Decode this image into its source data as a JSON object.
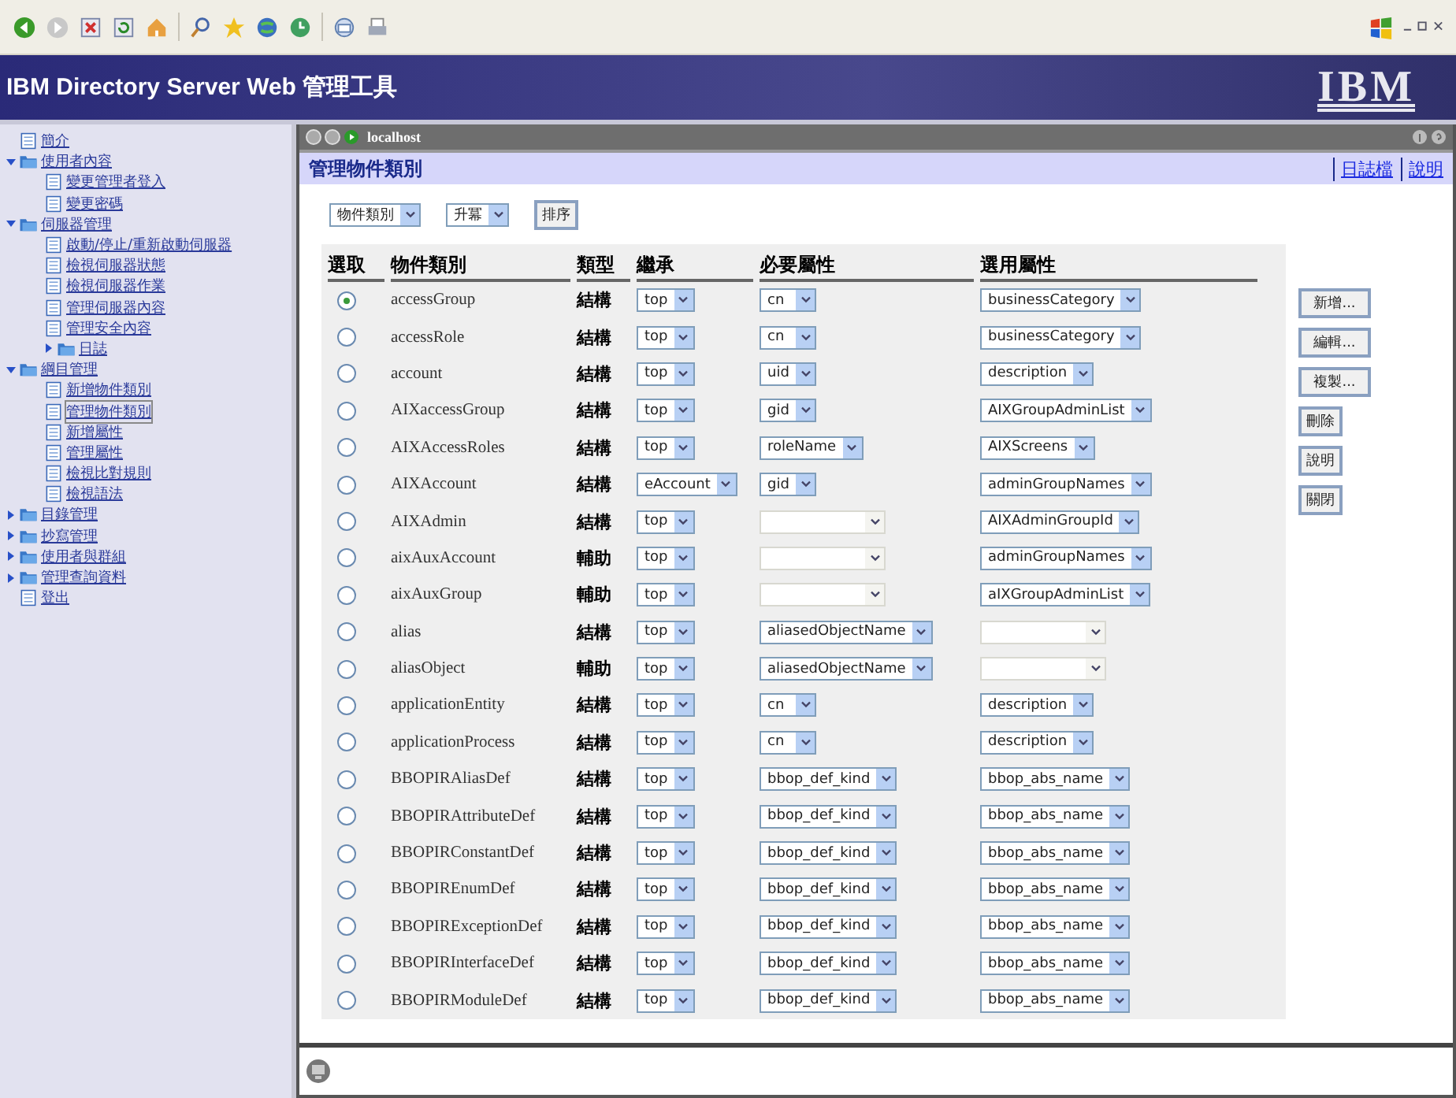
{
  "banner": {
    "title": "IBM Directory Server Web 管理工具",
    "logo": "IBM"
  },
  "sidebar": {
    "items": [
      {
        "label": "簡介",
        "kind": "page"
      },
      {
        "label": "使用者內容",
        "kind": "folder",
        "expanded": true,
        "children": [
          {
            "label": "變更管理者登入",
            "kind": "page",
            "selected": false
          },
          {
            "label": "變更密碼",
            "kind": "page",
            "selected": false
          }
        ]
      },
      {
        "label": "伺服器管理",
        "kind": "folder",
        "expanded": true,
        "children": [
          {
            "label": "啟動/停止/重新啟動伺服器",
            "kind": "page",
            "selected": false
          },
          {
            "label": "檢視伺服器狀態",
            "kind": "page",
            "selected": false
          },
          {
            "label": "檢視伺服器作業",
            "kind": "page",
            "selected": false
          },
          {
            "label": "管理伺服器內容",
            "kind": "page",
            "selected": false
          },
          {
            "label": "管理安全內容",
            "kind": "page",
            "selected": false
          },
          {
            "label": "日誌",
            "kind": "folder",
            "expanded": false
          }
        ]
      },
      {
        "label": "綱目管理",
        "kind": "folder",
        "expanded": true,
        "children": [
          {
            "label": "新增物件類別",
            "kind": "page",
            "selected": false
          },
          {
            "label": "管理物件類別",
            "kind": "page",
            "selected": true
          },
          {
            "label": "新增屬性",
            "kind": "page",
            "selected": false
          },
          {
            "label": "管理屬性",
            "kind": "page",
            "selected": false
          },
          {
            "label": "檢視比對規則",
            "kind": "page",
            "selected": false
          },
          {
            "label": "檢視語法",
            "kind": "page",
            "selected": false
          }
        ]
      },
      {
        "label": "目錄管理",
        "kind": "folder",
        "expanded": false
      },
      {
        "label": "抄寫管理",
        "kind": "folder",
        "expanded": false
      },
      {
        "label": "使用者與群組",
        "kind": "folder",
        "expanded": false
      },
      {
        "label": "管理查詢資料",
        "kind": "folder",
        "expanded": false
      },
      {
        "label": "登出",
        "kind": "page"
      }
    ]
  },
  "frame": {
    "title": "localhost"
  },
  "page": {
    "title": "管理物件類別",
    "links": [
      "日誌檔",
      "說明"
    ]
  },
  "sort": {
    "field": "物件類別",
    "order": "升冪",
    "button": "排序"
  },
  "table": {
    "columns": [
      "選取",
      "物件類別",
      "類型",
      "繼承",
      "必要屬性",
      "選用屬性"
    ],
    "rows": [
      {
        "selected": true,
        "name": "accessGroup",
        "type": "結構",
        "inherit": "top",
        "required": {
          "value": "cn",
          "disabled": false
        },
        "optional": {
          "value": "businessCategory",
          "disabled": false
        }
      },
      {
        "selected": false,
        "name": "accessRole",
        "type": "結構",
        "inherit": "top",
        "required": {
          "value": "cn",
          "disabled": false
        },
        "optional": {
          "value": "businessCategory",
          "disabled": false
        }
      },
      {
        "selected": false,
        "name": "account",
        "type": "結構",
        "inherit": "top",
        "required": {
          "value": "uid",
          "disabled": false
        },
        "optional": {
          "value": "description",
          "disabled": false
        }
      },
      {
        "selected": false,
        "name": "AIXaccessGroup",
        "type": "結構",
        "inherit": "top",
        "required": {
          "value": "gid",
          "disabled": false
        },
        "optional": {
          "value": "AIXGroupAdminList",
          "disabled": false
        }
      },
      {
        "selected": false,
        "name": "AIXAccessRoles",
        "type": "結構",
        "inherit": "top",
        "required": {
          "value": "roleName",
          "disabled": false
        },
        "optional": {
          "value": "AIXScreens",
          "disabled": false
        }
      },
      {
        "selected": false,
        "name": "AIXAccount",
        "type": "結構",
        "inherit": "eAccount",
        "required": {
          "value": "gid",
          "disabled": false
        },
        "optional": {
          "value": "adminGroupNames",
          "disabled": false
        }
      },
      {
        "selected": false,
        "name": "AIXAdmin",
        "type": "結構",
        "inherit": "top",
        "required": {
          "disabled": true
        },
        "optional": {
          "value": "AIXAdminGroupId",
          "disabled": false
        }
      },
      {
        "selected": false,
        "name": "aixAuxAccount",
        "type": "輔助",
        "inherit": "top",
        "required": {
          "disabled": true
        },
        "optional": {
          "value": "adminGroupNames",
          "disabled": false
        }
      },
      {
        "selected": false,
        "name": "aixAuxGroup",
        "type": "輔助",
        "inherit": "top",
        "required": {
          "disabled": true
        },
        "optional": {
          "value": "aIXGroupAdminList",
          "disabled": false
        }
      },
      {
        "selected": false,
        "name": "alias",
        "type": "結構",
        "inherit": "top",
        "required": {
          "value": "aliasedObjectName",
          "disabled": false
        },
        "optional": {
          "disabled": true
        }
      },
      {
        "selected": false,
        "name": "aliasObject",
        "type": "輔助",
        "inherit": "top",
        "required": {
          "value": "aliasedObjectName",
          "disabled": false
        },
        "optional": {
          "disabled": true
        }
      },
      {
        "selected": false,
        "name": "applicationEntity",
        "type": "結構",
        "inherit": "top",
        "required": {
          "value": "cn",
          "disabled": false
        },
        "optional": {
          "value": "description",
          "disabled": false
        }
      },
      {
        "selected": false,
        "name": "applicationProcess",
        "type": "結構",
        "inherit": "top",
        "required": {
          "value": "cn",
          "disabled": false
        },
        "optional": {
          "value": "description",
          "disabled": false
        }
      },
      {
        "selected": false,
        "name": "BBOPIRAliasDef",
        "type": "結構",
        "inherit": "top",
        "required": {
          "value": "bbop_def_kind",
          "disabled": false
        },
        "optional": {
          "value": "bbop_abs_name",
          "disabled": false
        }
      },
      {
        "selected": false,
        "name": "BBOPIRAttributeDef",
        "type": "結構",
        "inherit": "top",
        "required": {
          "value": "bbop_def_kind",
          "disabled": false
        },
        "optional": {
          "value": "bbop_abs_name",
          "disabled": false
        }
      },
      {
        "selected": false,
        "name": "BBOPIRConstantDef",
        "type": "結構",
        "inherit": "top",
        "required": {
          "value": "bbop_def_kind",
          "disabled": false
        },
        "optional": {
          "value": "bbop_abs_name",
          "disabled": false
        }
      },
      {
        "selected": false,
        "name": "BBOPIREnumDef",
        "type": "結構",
        "inherit": "top",
        "required": {
          "value": "bbop_def_kind",
          "disabled": false
        },
        "optional": {
          "value": "bbop_abs_name",
          "disabled": false
        }
      },
      {
        "selected": false,
        "name": "BBOPIRExceptionDef",
        "type": "結構",
        "inherit": "top",
        "required": {
          "value": "bbop_def_kind",
          "disabled": false
        },
        "optional": {
          "value": "bbop_abs_name",
          "disabled": false
        }
      },
      {
        "selected": false,
        "name": "BBOPIRInterfaceDef",
        "type": "結構",
        "inherit": "top",
        "required": {
          "value": "bbop_def_kind",
          "disabled": false
        },
        "optional": {
          "value": "bbop_abs_name",
          "disabled": false
        }
      },
      {
        "selected": false,
        "name": "BBOPIRModuleDef",
        "type": "結構",
        "inherit": "top",
        "required": {
          "value": "bbop_def_kind",
          "disabled": false
        },
        "optional": {
          "value": "bbop_abs_name",
          "disabled": false
        }
      }
    ]
  },
  "actions": [
    {
      "label": "新增...",
      "kind": "wide"
    },
    {
      "label": "編輯...",
      "kind": "wide"
    },
    {
      "label": "複製...",
      "kind": "wide"
    },
    {
      "label": "刪除",
      "kind": "small"
    },
    {
      "label": "說明",
      "kind": "small"
    },
    {
      "label": "關閉",
      "kind": "small"
    }
  ]
}
